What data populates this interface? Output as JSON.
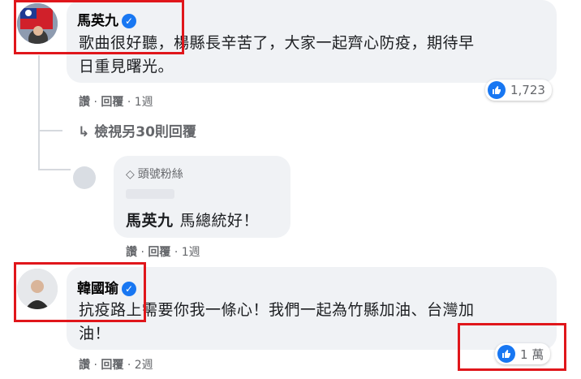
{
  "comments": [
    {
      "author": "馬英九",
      "text_line1": "歌曲很好聽，楊縣長辛苦了，大家一起齊心防疫，期待早",
      "text_line2": "日重見曙光。",
      "actions": {
        "like": "讚",
        "reply": "回覆",
        "time": "1週"
      },
      "reaction_count": "1,723"
    },
    {
      "author": "韓國瑜",
      "text_line1": "抗疫路上需要你我一條心！我們一起為竹縣加油、台灣加",
      "text_line2": "油！",
      "actions": {
        "like": "讚",
        "reply": "回覆",
        "time": "2週"
      },
      "reaction_count": "1 萬"
    }
  ],
  "view_more_replies": "檢視另30則回覆",
  "reply": {
    "badge": "頭號粉絲",
    "mention": "馬英九",
    "text": "馬總統好！",
    "actions": {
      "like": "讚",
      "reply": "回覆",
      "time": "1週"
    }
  },
  "separator": "·",
  "colors": {
    "accent": "#1877f2",
    "highlight": "#e0161b",
    "bubble": "#f0f2f5"
  },
  "icons": [
    "verified-icon",
    "like-icon",
    "reply-arrow-icon",
    "diamond-icon"
  ]
}
